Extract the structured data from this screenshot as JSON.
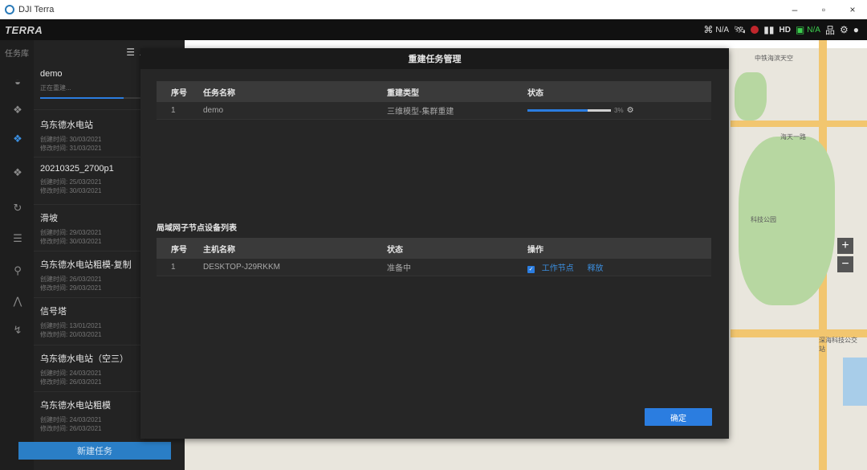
{
  "os": {
    "title": "DJI Terra",
    "minimize": "–",
    "maximize": "▫",
    "close": "×"
  },
  "header": {
    "brand": "TERRA",
    "status": {
      "rc_label": "N/A",
      "hd_label": "HD",
      "battery_label": "N/A"
    }
  },
  "sidebar": {
    "title": "任务库",
    "new_task_label": "新建任务",
    "tasks": [
      {
        "name": "demo",
        "line1": "正在重建...",
        "line2": "",
        "progress": 0.8
      },
      {
        "name": "乌东德水电站",
        "line1": "创建时间: 30/03/2021",
        "line2": "修改时间: 31/03/2021"
      },
      {
        "name": "20210325_2700p1",
        "line1": "创建时间: 25/03/2021",
        "line2": "修改时间: 30/03/2021"
      },
      {
        "name": "滑坡",
        "line1": "创建时间: 29/03/2021",
        "line2": "修改时间: 30/03/2021"
      },
      {
        "name": "乌东德水电站粗模-复制",
        "line1": "创建时间: 26/03/2021",
        "line2": "修改时间: 29/03/2021"
      },
      {
        "name": "信号塔",
        "line1": "创建时间: 13/01/2021",
        "line2": "修改时间: 20/03/2021"
      },
      {
        "name": "乌东德水电站（空三）",
        "line1": "创建时间: 24/03/2021",
        "line2": "修改时间: 26/03/2021"
      },
      {
        "name": "乌东德水电站粗模",
        "line1": "创建时间: 24/03/2021",
        "line2": "修改时间: 26/03/2021"
      }
    ]
  },
  "map": {
    "labels": [
      "中铁海滨天空",
      "海天一路",
      "科技公园",
      "深海科技公交站"
    ],
    "zoom_in": "+",
    "zoom_out": "−"
  },
  "modal": {
    "title": "重建任务管理",
    "task_table": {
      "headers": [
        "序号",
        "任务名称",
        "重建类型",
        "状态"
      ],
      "rows": [
        {
          "index": "1",
          "name": "demo",
          "type": "三维模型-集群重建",
          "progress": 0.72,
          "progress_text": "3%"
        }
      ]
    },
    "device_section_title": "局域网子节点设备列表",
    "device_table": {
      "headers": [
        "序号",
        "主机名称",
        "状态",
        "操作"
      ],
      "rows": [
        {
          "index": "1",
          "host": "DESKTOP-J29RKKM",
          "status": "准备中",
          "worker_label": "工作节点",
          "release_label": "释放"
        }
      ]
    },
    "ok_label": "确定"
  }
}
